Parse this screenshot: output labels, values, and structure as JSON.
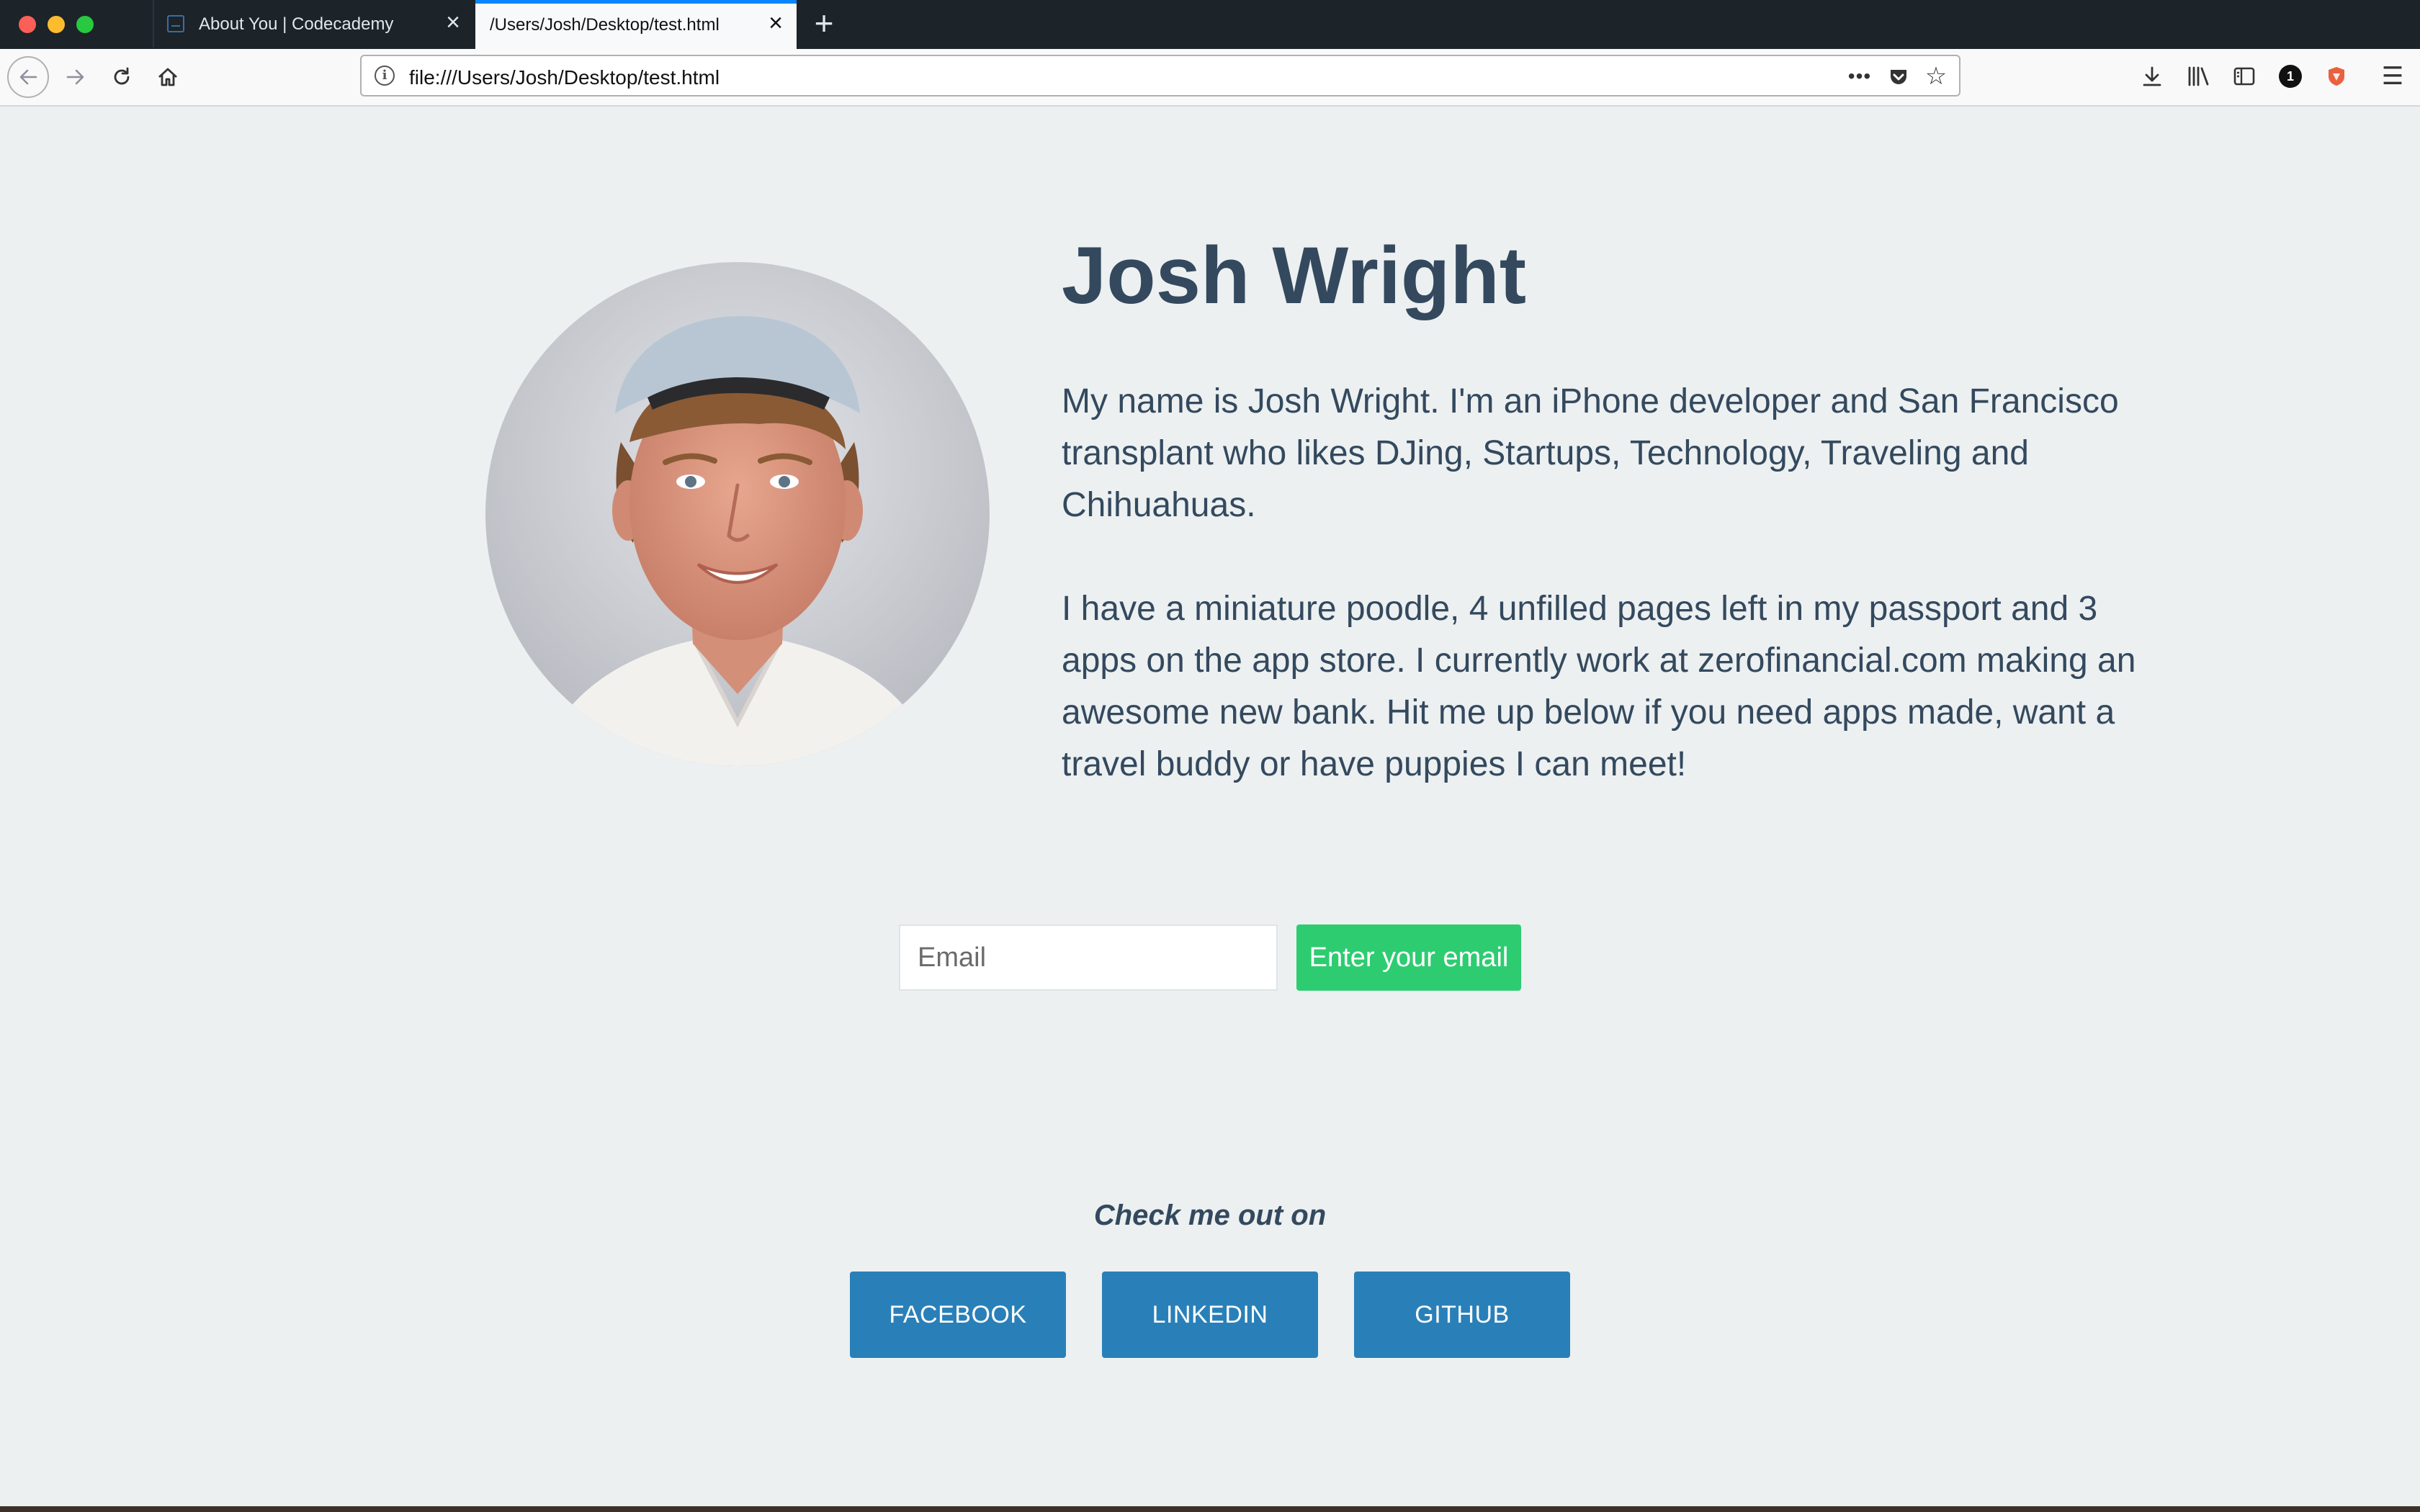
{
  "browser": {
    "tabs": [
      {
        "title": "About You | Codecademy",
        "active": false
      },
      {
        "title": "/Users/Josh/Desktop/test.html",
        "active": true
      }
    ],
    "new_tab_glyph": "+",
    "close_glyph": "×",
    "url": "file:///Users/Josh/Desktop/test.html",
    "onepassword_badge": "1",
    "accent_color": "#0a84ff"
  },
  "profile": {
    "name": "Josh Wright",
    "bio_paragraphs": [
      "My name is Josh Wright. I'm an iPhone developer and San Francisco transplant who likes DJing, Startups, Technology, Traveling and Chihuahuas.",
      "I have a miniature poodle, 4 unfilled pages left in my passport and 3 apps on the app store. I currently work at zerofinancial.com making an awesome new bank. Hit me up below if you need apps made, want a travel buddy or have puppies I can meet!"
    ],
    "text_color": "#34495e",
    "background_color": "#ecf0f1"
  },
  "signup": {
    "email_placeholder": "Email",
    "email_value": "",
    "submit_label": "Enter your email",
    "submit_color": "#2ecc71"
  },
  "social": {
    "heading": "Check me out on",
    "buttons": [
      {
        "label": "FACEBOOK"
      },
      {
        "label": "LINKEDIN"
      },
      {
        "label": "GITHUB"
      }
    ],
    "button_color": "#2980b9"
  }
}
